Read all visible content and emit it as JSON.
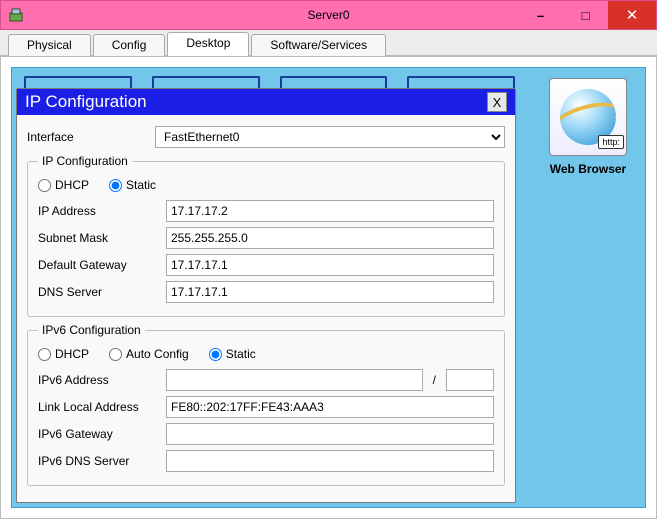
{
  "window": {
    "title": "Server0",
    "minimize_glyph": "–",
    "maximize_glyph": "□",
    "close_glyph": "✕"
  },
  "tabs": [
    "Physical",
    "Config",
    "Desktop",
    "Software/Services"
  ],
  "active_tab": "Desktop",
  "app_icon": {
    "label": "Web Browser",
    "http": "http:"
  },
  "dialog": {
    "title": "IP Configuration",
    "close_glyph": "X",
    "interface_label": "Interface",
    "interface_value": "FastEthernet0",
    "ipv4": {
      "legend": "IP Configuration",
      "radio_dhcp": "DHCP",
      "radio_static": "Static",
      "selected": "static",
      "ip_label": "IP Address",
      "ip_value": "17.17.17.2",
      "mask_label": "Subnet Mask",
      "mask_value": "255.255.255.0",
      "gw_label": "Default Gateway",
      "gw_value": "17.17.17.1",
      "dns_label": "DNS Server",
      "dns_value": "17.17.17.1"
    },
    "ipv6": {
      "legend": "IPv6 Configuration",
      "radio_dhcp": "DHCP",
      "radio_auto": "Auto Config",
      "radio_static": "Static",
      "selected": "static",
      "addr_label": "IPv6 Address",
      "addr_value": "",
      "prefix_sep": "/",
      "prefix_value": "",
      "ll_label": "Link Local Address",
      "ll_value": "FE80::202:17FF:FE43:AAA3",
      "gw_label": "IPv6 Gateway",
      "gw_value": "",
      "dns_label": "IPv6 DNS Server",
      "dns_value": ""
    }
  }
}
